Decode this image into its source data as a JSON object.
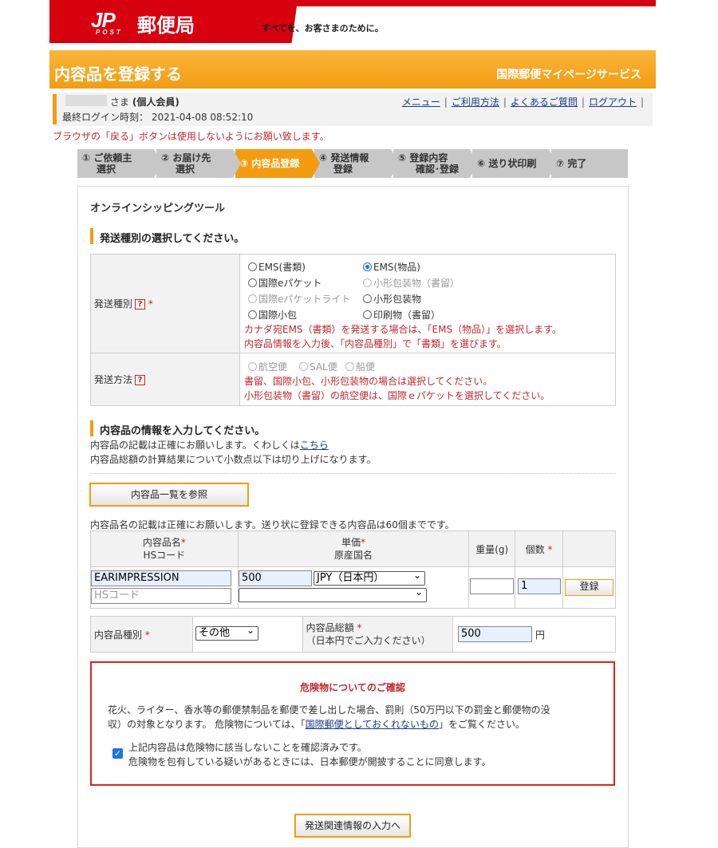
{
  "header": {
    "logo_jp": "JP",
    "logo_post": "POST",
    "logo_text": "郵便局",
    "slogan": "すべてを、お客さまのために。"
  },
  "titlebar": {
    "title": "内容品を登録する",
    "service": "国際郵便マイページサービス"
  },
  "user": {
    "honorific": "さま",
    "member_type": "(個人会員)",
    "last_login_label": "最終ログイン時刻：",
    "last_login": "2021-04-08 08:52:10",
    "links": [
      "メニュー",
      "ご利用方法",
      "よくあるご質問",
      "ログアウト"
    ]
  },
  "warning": "ブラウザの「戻る」ボタンは使用しないようにお願い致します。",
  "steps": [
    {
      "l1": "① ご依頼主",
      "l2": "選択"
    },
    {
      "l1": "② お届け先",
      "l2": "選択"
    },
    {
      "l1": "③ 内容品登録",
      "l2": ""
    },
    {
      "l1": "④ 発送情報",
      "l2": "登録"
    },
    {
      "l1": "⑤ 登録内容",
      "l2": "確認･登録"
    },
    {
      "l1": "⑥ 送り状印刷",
      "l2": ""
    },
    {
      "l1": "⑦ 完了",
      "l2": ""
    }
  ],
  "panel": {
    "heading": "オンラインシッピングツール",
    "section1": "発送種別の選択してください。",
    "ship_type_label": "発送種別",
    "ship_types": [
      {
        "label": "EMS(書類)",
        "checked": false,
        "disabled": false
      },
      {
        "label": "EMS(物品)",
        "checked": true,
        "disabled": false
      },
      {
        "label": "国際eパケット",
        "checked": false,
        "disabled": false
      },
      {
        "label": "小形包装物（書留）",
        "checked": false,
        "disabled": true
      },
      {
        "label": "国際eパケットライト",
        "checked": false,
        "disabled": true
      },
      {
        "label": "小形包装物",
        "checked": false,
        "disabled": false
      },
      {
        "label": "国際小包",
        "checked": false,
        "disabled": false
      },
      {
        "label": "印刷物（書留）",
        "checked": false,
        "disabled": false
      }
    ],
    "ship_type_note1": "カナダ宛EMS（書類）を発送する場合は、「EMS（物品）」を選択します。",
    "ship_type_note2": "内容品情報を入力後、「内容品種別」で「書類」を選びます。",
    "method_label": "発送方法",
    "methods": [
      "航空便",
      "SAL便",
      "船便"
    ],
    "method_note1": "書留、国際小包、小形包装物の場合は選択してください。",
    "method_note2": "小形包装物（書留）の航空便は、国際ｅパケットを選択してください。",
    "section2": "内容品の情報を入力してください。",
    "info1_pre": "内容品の記載は正確にお願いします。くわしくは",
    "info1_link": "こちら",
    "info2": "内容品総額の計算結果について小数点以下は切り上げになります。",
    "browse_button": "内容品一覧を参照",
    "items_note": "内容品名の記載は正確にお願いします。送り状に登録できる内容品は60個までです。",
    "col_name": "内容品名",
    "col_hs": "HSコード",
    "col_price": "単価",
    "col_origin": "原産国名",
    "col_weight": "重量(g)",
    "col_qty": "個数",
    "item": {
      "name": "EARIMPRESSION",
      "hs_placeholder": "HSコード",
      "price": "500",
      "currency": "JPY（日本円）",
      "origin": "",
      "weight": "",
      "qty": "1"
    },
    "register_button": "登録",
    "category_label": "内容品種別",
    "category_value": "その他",
    "total_label1": "内容品総額",
    "total_label2": "（日本円でご入力ください）",
    "total_value": "500",
    "total_unit": "円",
    "req_mark": "*"
  },
  "danger": {
    "title": "危険物についてのご確認",
    "body1": "花火、ライター、香水等の郵便禁制品を郵便で差し出した場合、罰則（50万円以下の罰金と郵便物の没",
    "body2_pre": "収）の対象となります。 危険物については、「",
    "body2_link": "国際郵便としておくれないもの",
    "body2_post": "」をご覧ください。",
    "check_line1": "上記内容品は危険物に該当しないことを確認済みです。",
    "check_line2": "危険物を包有している疑いがあるときには、日本郵便が開披することに同意します。",
    "checked": true
  },
  "next_button": "発送関連情報の入力へ",
  "colors": {
    "brand_red": "#d7000f",
    "accent_orange": "#f39c12",
    "warning_red": "#c0282d",
    "link_blue": "#1a3a8c"
  }
}
